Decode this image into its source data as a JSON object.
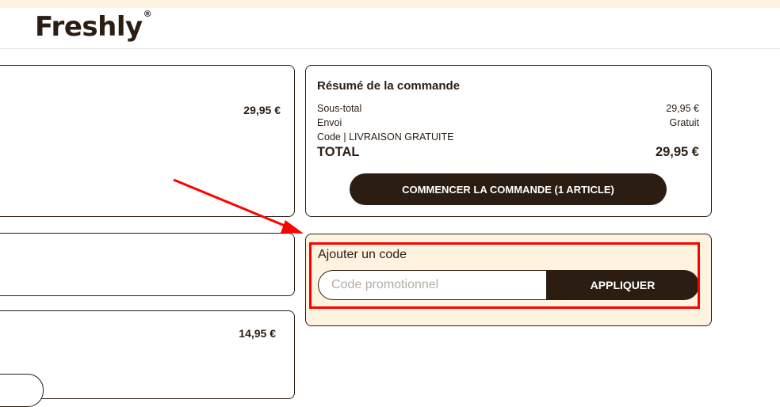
{
  "brand": {
    "name": "Freshly",
    "mark": "®"
  },
  "cart": {
    "item1_price": "29,95 €",
    "item3_price": "14,95 €"
  },
  "summary": {
    "title": "Résumé de la commande",
    "rows": [
      {
        "label": "Sous-total",
        "value": "29,95 €"
      },
      {
        "label": "Envoi",
        "value": "Gratuit"
      },
      {
        "label": "Code | LIVRAISON GRATUITE",
        "value": ""
      }
    ],
    "total_label": "TOTAL",
    "total_value": "29,95 €",
    "checkout_label": "COMMENCER LA COMMANDE (1 ARTICLE)"
  },
  "promo": {
    "title": "Ajouter un code",
    "placeholder": "Code promotionnel",
    "value": "",
    "apply_label": "APPLIQUER"
  },
  "colors": {
    "brand_dark": "#2b1d12",
    "cream": "#fdf3df",
    "annotation_red": "#ff0000"
  }
}
